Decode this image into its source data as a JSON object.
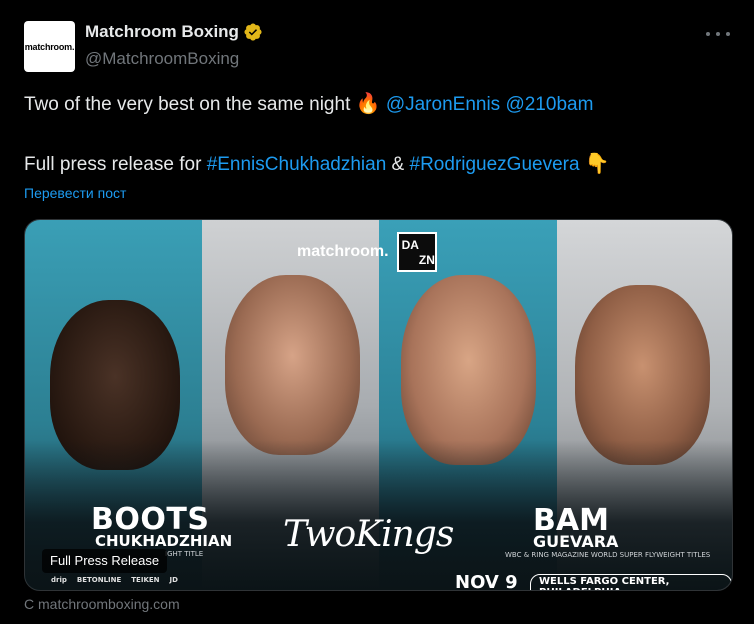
{
  "author": {
    "avatar_text": "matchroom.",
    "display_name": "Matchroom Boxing",
    "handle": "@MatchroomBoxing",
    "verified_color": "#e2b719"
  },
  "tweet": {
    "line1_text": "Two of the very best on the same night",
    "line1_emoji": "🔥",
    "mention1": "@JaronEnnis",
    "mention2": "@210bam",
    "line2_prefix": "Full press release for",
    "hashtag1": "#EnnisChukhadzhian",
    "ampersand": "&",
    "hashtag2": "#RodriguezGuevera",
    "line2_emoji": "👇",
    "translate_link": "Перевести пост"
  },
  "card": {
    "brand": "matchroom.",
    "dazn": [
      "DA",
      "ZN"
    ],
    "fighter1": "BOOTS",
    "fighter2": "CHUKHADZHIAN",
    "fighter2_title": "IGHT TITLE",
    "center_title": "TwoKings",
    "fighter3": "BAM",
    "fighter4": "GUEVARA",
    "fighter4_title": "WBC & RING MAGAZINE WORLD SUPER FLYWEIGHT TITLES",
    "date": "NOV 9",
    "venue": "WELLS FARGO CENTER, PHILADELPHIA",
    "sponsors": [
      "drip",
      "BETONLINE",
      "TEIKEN",
      "JD"
    ],
    "overlay_label": "Full Press Release",
    "source": "С matchroomboxing.com"
  },
  "colors": {
    "link": "#1d9bf0",
    "muted": "#71767b",
    "text": "#e7e9ea",
    "background": "#000000"
  }
}
